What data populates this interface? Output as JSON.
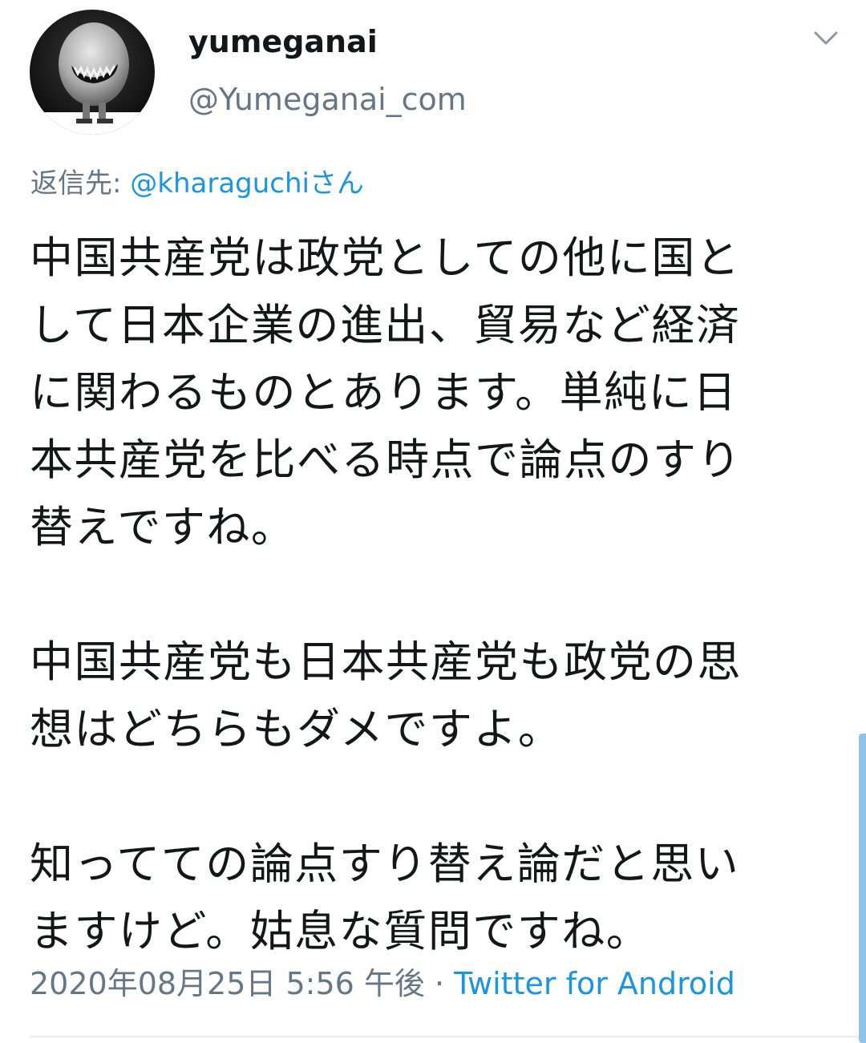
{
  "tweet": {
    "display_name": "yumeganai",
    "handle": "@Yumeganai_com",
    "reply_prefix": "返信先: ",
    "reply_mention": "@kharaguchiさん",
    "paragraphs": [
      [
        "中国共産党は政党としての他に国と",
        "して日本企業の進出、貿易など経済",
        "に関わるものとあります。単純に日",
        "本共産党を比べる時点で論点のすり",
        "替えですね。"
      ],
      [
        "中国共産党も日本共産党も政党の思",
        "想はどちらもダメですよ。"
      ],
      [
        "知ってての論点すり替え論だと思い",
        "ますけど。姑息な質問ですね。"
      ]
    ],
    "timestamp": "2020年08月25日 5:56 午後",
    "separator": " · ",
    "source": "Twitter for Android"
  },
  "icons": {
    "avatar": "avatar-image",
    "caret": "chevron-down-icon"
  },
  "colors": {
    "text": "#14171a",
    "secondary": "#657786",
    "link": "#1b95e0"
  }
}
